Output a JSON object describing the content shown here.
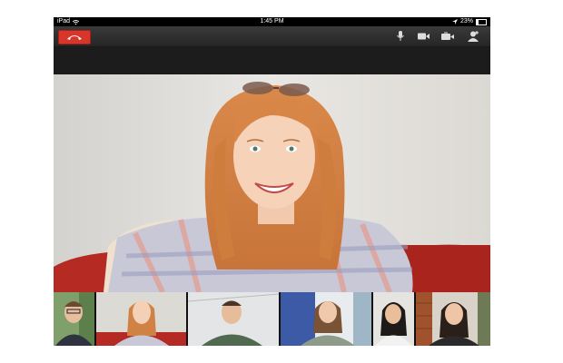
{
  "status_bar": {
    "device": "iPad",
    "time": "1:45 PM",
    "battery": "23%",
    "battery_level": 0.23
  },
  "toolbar": {
    "icons": [
      "end-call-icon",
      "microphone-icon",
      "video-camera-icon",
      "switch-camera-icon",
      "add-person-icon"
    ]
  },
  "colors": {
    "hangup": "#d9362b",
    "toolbar": "#2e2e2e",
    "sofa": "#b52a22",
    "wall": "#e2dfdb"
  },
  "participants": [
    {
      "id": "main-speaker",
      "role": "main video"
    },
    {
      "id": "participant-1"
    },
    {
      "id": "participant-2"
    },
    {
      "id": "participant-3"
    },
    {
      "id": "participant-4"
    },
    {
      "id": "participant-5"
    },
    {
      "id": "participant-6"
    }
  ]
}
